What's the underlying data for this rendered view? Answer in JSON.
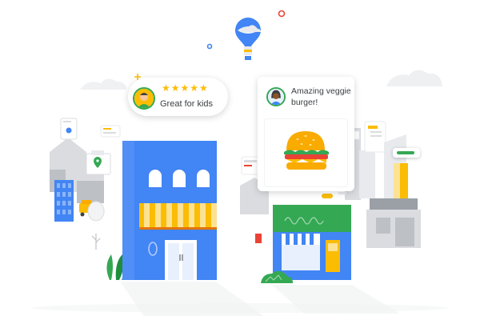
{
  "review_cards": [
    {
      "rating_stars": "★★★★★",
      "text": "Great for kids"
    },
    {
      "text": "Amazing veggie burger!"
    }
  ],
  "colors": {
    "blue": "#4285f4",
    "yellow": "#fbbc04",
    "green": "#34a853",
    "red": "#ea4335",
    "grey": "#dadce0"
  },
  "icons": [
    "balloon-icon",
    "map-pin-icon",
    "rickshaw-icon",
    "burger-icon",
    "tree-icon",
    "plant-icon"
  ]
}
